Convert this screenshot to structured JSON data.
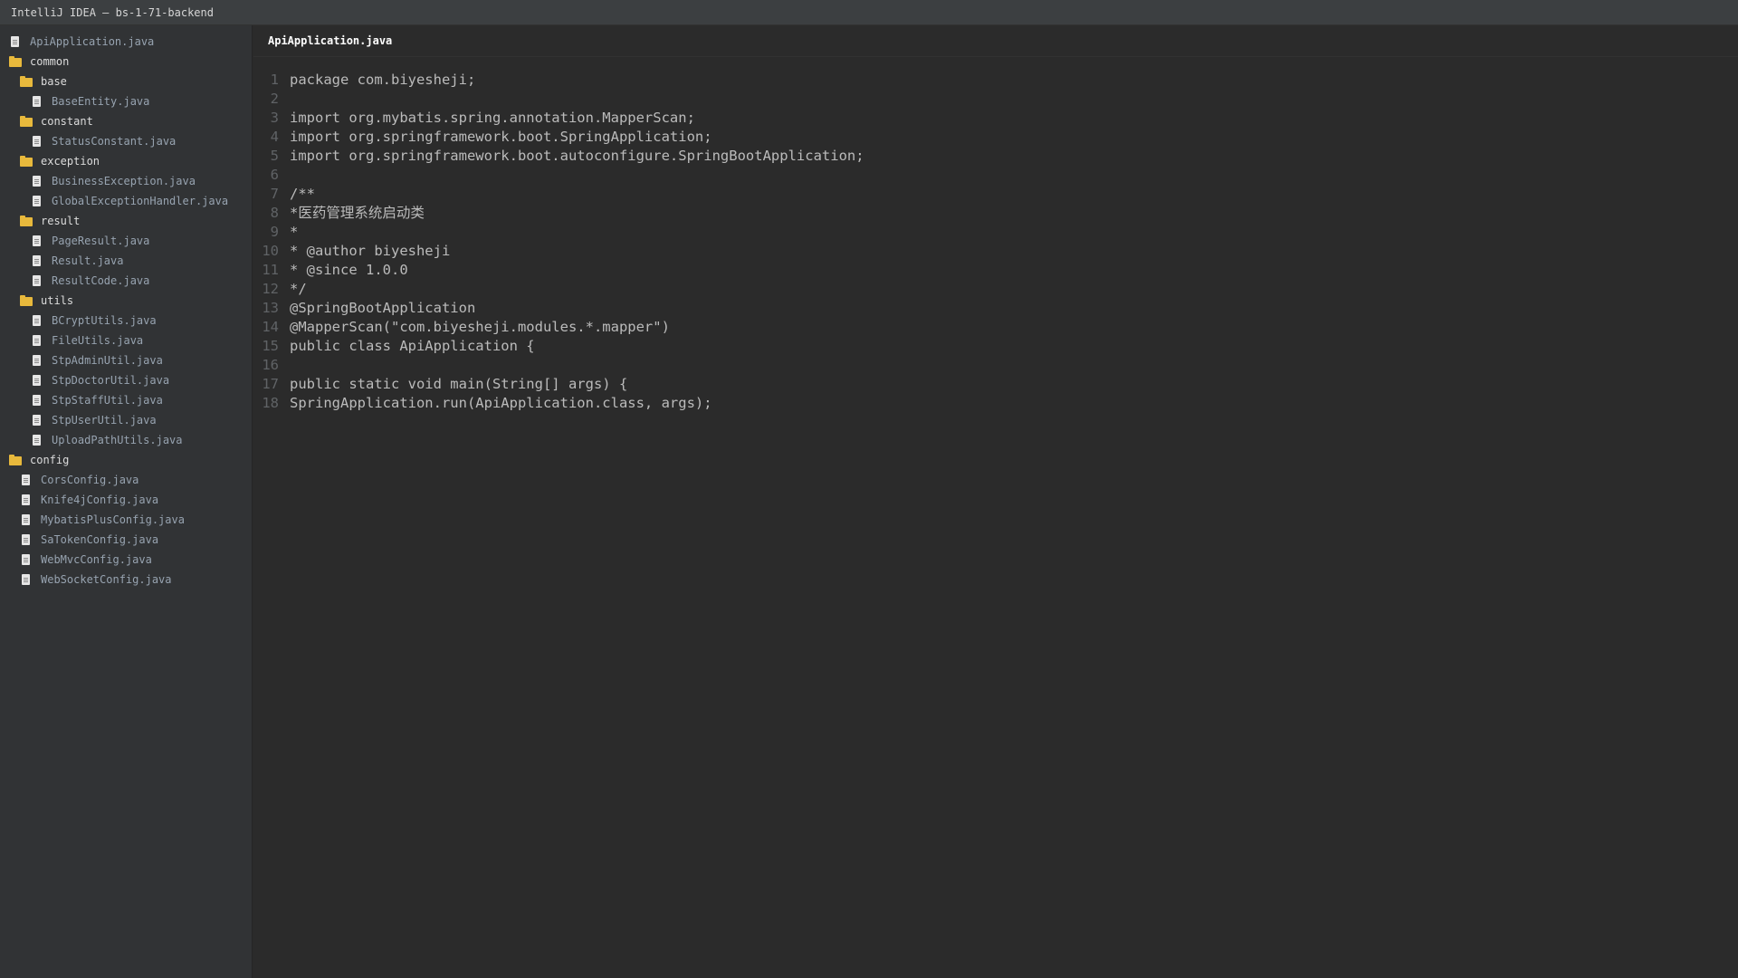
{
  "window": {
    "title": "IntelliJ IDEA — bs-1-71-backend"
  },
  "sidebar": {
    "items": [
      {
        "label": "ApiApplication.java",
        "type": "file",
        "level": 0
      },
      {
        "label": "common",
        "type": "folder",
        "level": 0
      },
      {
        "label": "base",
        "type": "folder",
        "level": 1
      },
      {
        "label": "BaseEntity.java",
        "type": "file",
        "level": 2
      },
      {
        "label": "constant",
        "type": "folder",
        "level": 1
      },
      {
        "label": "StatusConstant.java",
        "type": "file",
        "level": 2
      },
      {
        "label": "exception",
        "type": "folder",
        "level": 1
      },
      {
        "label": "BusinessException.java",
        "type": "file",
        "level": 2
      },
      {
        "label": "GlobalExceptionHandler.java",
        "type": "file",
        "level": 2
      },
      {
        "label": "result",
        "type": "folder",
        "level": 1
      },
      {
        "label": "PageResult.java",
        "type": "file",
        "level": 2
      },
      {
        "label": "Result.java",
        "type": "file",
        "level": 2
      },
      {
        "label": "ResultCode.java",
        "type": "file",
        "level": 2
      },
      {
        "label": "utils",
        "type": "folder",
        "level": 1
      },
      {
        "label": "BCryptUtils.java",
        "type": "file",
        "level": 2
      },
      {
        "label": "FileUtils.java",
        "type": "file",
        "level": 2
      },
      {
        "label": "StpAdminUtil.java",
        "type": "file",
        "level": 2
      },
      {
        "label": "StpDoctorUtil.java",
        "type": "file",
        "level": 2
      },
      {
        "label": "StpStaffUtil.java",
        "type": "file",
        "level": 2
      },
      {
        "label": "StpUserUtil.java",
        "type": "file",
        "level": 2
      },
      {
        "label": "UploadPathUtils.java",
        "type": "file",
        "level": 2
      },
      {
        "label": "config",
        "type": "folder",
        "level": 0
      },
      {
        "label": "CorsConfig.java",
        "type": "file",
        "level": 1
      },
      {
        "label": "Knife4jConfig.java",
        "type": "file",
        "level": 1
      },
      {
        "label": "MybatisPlusConfig.java",
        "type": "file",
        "level": 1
      },
      {
        "label": "SaTokenConfig.java",
        "type": "file",
        "level": 1
      },
      {
        "label": "WebMvcConfig.java",
        "type": "file",
        "level": 1
      },
      {
        "label": "WebSocketConfig.java",
        "type": "file",
        "level": 1
      }
    ]
  },
  "editor": {
    "active_tab": "ApiApplication.java",
    "lines": [
      {
        "n": "1",
        "text": "package com.biyesheji;"
      },
      {
        "n": "2",
        "text": ""
      },
      {
        "n": "3",
        "text": "import org.mybatis.spring.annotation.MapperScan;"
      },
      {
        "n": "4",
        "text": "import org.springframework.boot.SpringApplication;"
      },
      {
        "n": "5",
        "text": "import org.springframework.boot.autoconfigure.SpringBootApplication;"
      },
      {
        "n": "6",
        "text": ""
      },
      {
        "n": "7",
        "text": "/**"
      },
      {
        "n": "8",
        "text": "*医药管理系统启动类"
      },
      {
        "n": "9",
        "text": "*"
      },
      {
        "n": "10",
        "text": "* @author biyesheji"
      },
      {
        "n": "11",
        "text": "* @since 1.0.0"
      },
      {
        "n": "12",
        "text": "*/"
      },
      {
        "n": "13",
        "text": "@SpringBootApplication"
      },
      {
        "n": "14",
        "text": "@MapperScan(\"com.biyesheji.modules.*.mapper\")"
      },
      {
        "n": "15",
        "text": "public class ApiApplication {"
      },
      {
        "n": "16",
        "text": ""
      },
      {
        "n": "17",
        "text": "public static void main(String[] args) {"
      },
      {
        "n": "18",
        "text": "SpringApplication.run(ApiApplication.class, args);"
      }
    ]
  }
}
